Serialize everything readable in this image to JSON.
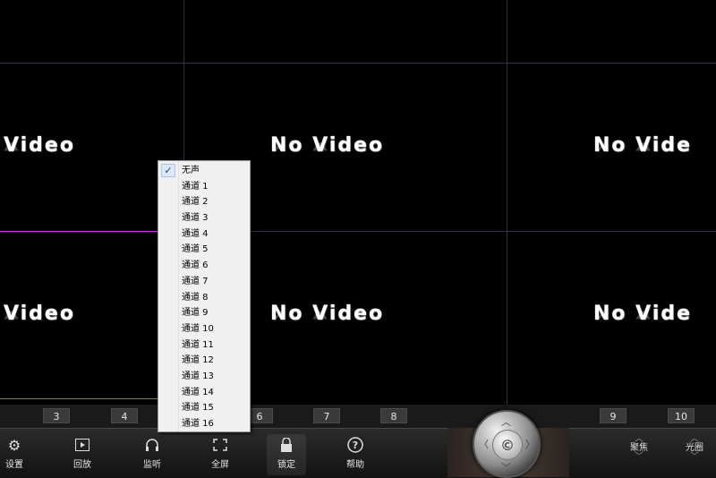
{
  "video_tiles": [
    {
      "label": "Video"
    },
    {
      "label": "No Video"
    },
    {
      "label": "No Vide"
    },
    {
      "label": "Video"
    },
    {
      "label": "No Video"
    },
    {
      "label": "No Vide"
    }
  ],
  "tile_numbers": [
    "3",
    "4",
    "6",
    "7",
    "8",
    "9",
    "10"
  ],
  "toolbar": {
    "settings": "设置",
    "playback": "回放",
    "listen": "监听",
    "fullscreen": "全屏",
    "lock": "锁定",
    "help": "帮助"
  },
  "side_controls": {
    "focus": "聚焦",
    "iris": "光圈"
  },
  "audio_menu": {
    "items": [
      {
        "label": "无声",
        "checked": true
      },
      {
        "label": "通道 1"
      },
      {
        "label": "通道 2"
      },
      {
        "label": "通道 3"
      },
      {
        "label": "通道 4"
      },
      {
        "label": "通道 5"
      },
      {
        "label": "通道 6"
      },
      {
        "label": "通道 7"
      },
      {
        "label": "通道 8"
      },
      {
        "label": "通道 9"
      },
      {
        "label": "通道 10"
      },
      {
        "label": "通道 11"
      },
      {
        "label": "通道 12"
      },
      {
        "label": "通道 13"
      },
      {
        "label": "通道 14"
      },
      {
        "label": "通道 15"
      },
      {
        "label": "通道 16"
      }
    ]
  },
  "colors": {
    "background": "#000000",
    "grid_line": "#2e3148",
    "selected_tile_line": "#c83cc8",
    "menu_bg": "#f0f0f0"
  }
}
